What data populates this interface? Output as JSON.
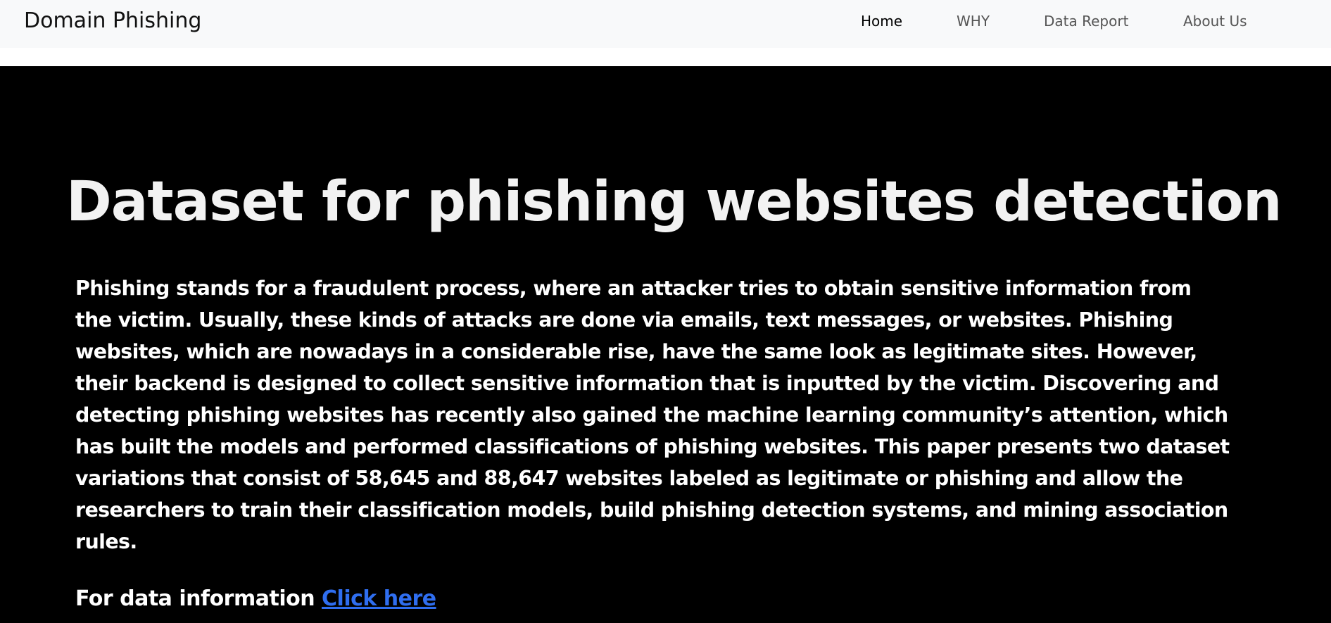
{
  "navbar": {
    "brand": "Domain Phishing",
    "links": [
      {
        "label": "Home",
        "active": true
      },
      {
        "label": "WHY",
        "active": false
      },
      {
        "label": "Data Report",
        "active": false
      },
      {
        "label": "About Us",
        "active": false
      }
    ]
  },
  "hero": {
    "title": "Dataset for phishing websites detection",
    "paragraph": "Phishing stands for a fraudulent process, where an attacker tries to obtain sensitive information from the victim. Usually, these kinds of attacks are done via emails, text messages, or websites. Phishing websites, which are nowadays in a considerable rise, have the same look as legitimate sites. However, their backend is designed to collect sensitive information that is inputted by the victim. Discovering and detecting phishing websites has recently also gained the machine learning community’s attention, which has built the models and performed classifications of phishing websites. This paper presents two dataset variations that consist of 58,645 and 88,647 websites labeled as legitimate or phishing and allow the researchers to train their classification models, build phishing detection systems, and mining association rules.",
    "data_info_prefix": "For data information ",
    "data_info_link": "Click here"
  },
  "colors": {
    "navbar_bg": "#f8f9fa",
    "hero_bg": "#000000",
    "link": "#2f6ef0"
  }
}
